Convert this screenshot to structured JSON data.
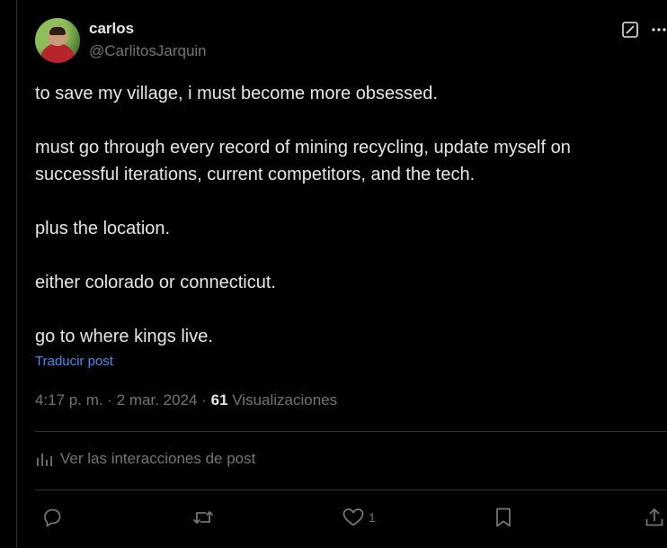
{
  "author": {
    "display_name": "carlos",
    "handle": "@CarlitosJarquin"
  },
  "tweet": {
    "paragraphs": [
      "to save my village, i must become more obsessed.",
      "must go through every record of mining recycling, update myself on\nsuccessful iterations, current competitors, and the tech.",
      "plus the location.",
      "either colorado or connecticut.",
      "go to where kings live."
    ],
    "translate_label": "Traducir post",
    "time": "4:17 p. m.",
    "date": "2 mar. 2024",
    "views_count": "61",
    "views_label": "Visualizaciones"
  },
  "analytics": {
    "label": "Ver las interacciones de post"
  },
  "actions": {
    "like_count": "1"
  },
  "icons": {
    "edit": "edit-icon",
    "more": "more-icon",
    "analytics": "bar-chart-icon",
    "reply": "reply-icon",
    "repost": "repost-icon",
    "like": "heart-icon",
    "bookmark": "bookmark-icon",
    "share": "share-icon"
  },
  "colors": {
    "background": "#000000",
    "text": "#e7e9ea",
    "muted": "#71767b",
    "link": "#4a8ef0",
    "divider": "#2f3336"
  }
}
